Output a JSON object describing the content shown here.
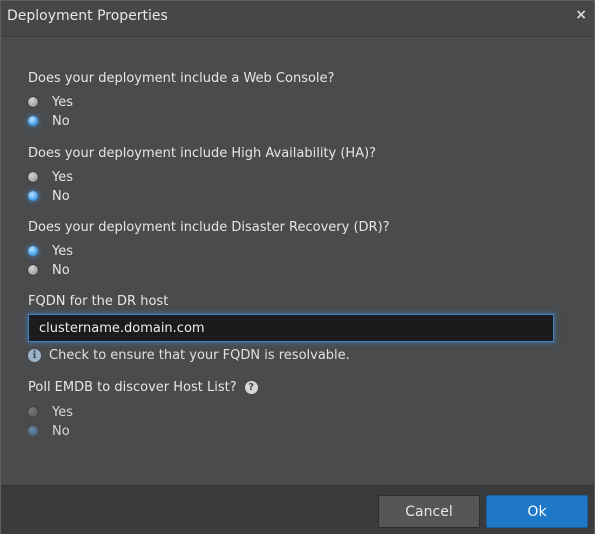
{
  "dialog": {
    "title": "Deployment Properties",
    "close_glyph": "×"
  },
  "questions": [
    {
      "text": "Does your deployment include a Web Console?",
      "options": [
        {
          "label": "Yes",
          "selected": false
        },
        {
          "label": "No",
          "selected": true
        }
      ]
    },
    {
      "text": "Does your deployment include High Availability (HA)?",
      "options": [
        {
          "label": "Yes",
          "selected": false
        },
        {
          "label": "No",
          "selected": true
        }
      ]
    },
    {
      "text": "Does your deployment include Disaster Recovery (DR)?",
      "options": [
        {
          "label": "Yes",
          "selected": true
        },
        {
          "label": "No",
          "selected": false
        }
      ]
    }
  ],
  "fqdn": {
    "label": "FQDN for the DR host",
    "value": "clustername.domain.com",
    "hint": "Check to ensure that your FQDN is resolvable.",
    "info_icon": "i"
  },
  "poll": {
    "text": "Poll EMDB to discover Host List?",
    "help_icon": "?",
    "options": [
      {
        "label": "Yes",
        "selected": false,
        "disabled": true
      },
      {
        "label": "No",
        "selected": true,
        "disabled": true
      }
    ]
  },
  "footer": {
    "cancel_label": "Cancel",
    "ok_label": "Ok"
  },
  "colors": {
    "accent": "#1f78c6",
    "dialog_bg": "#4a4b4d",
    "footer_bg": "#3a3b3d",
    "input_bg": "#1a1b1c"
  }
}
